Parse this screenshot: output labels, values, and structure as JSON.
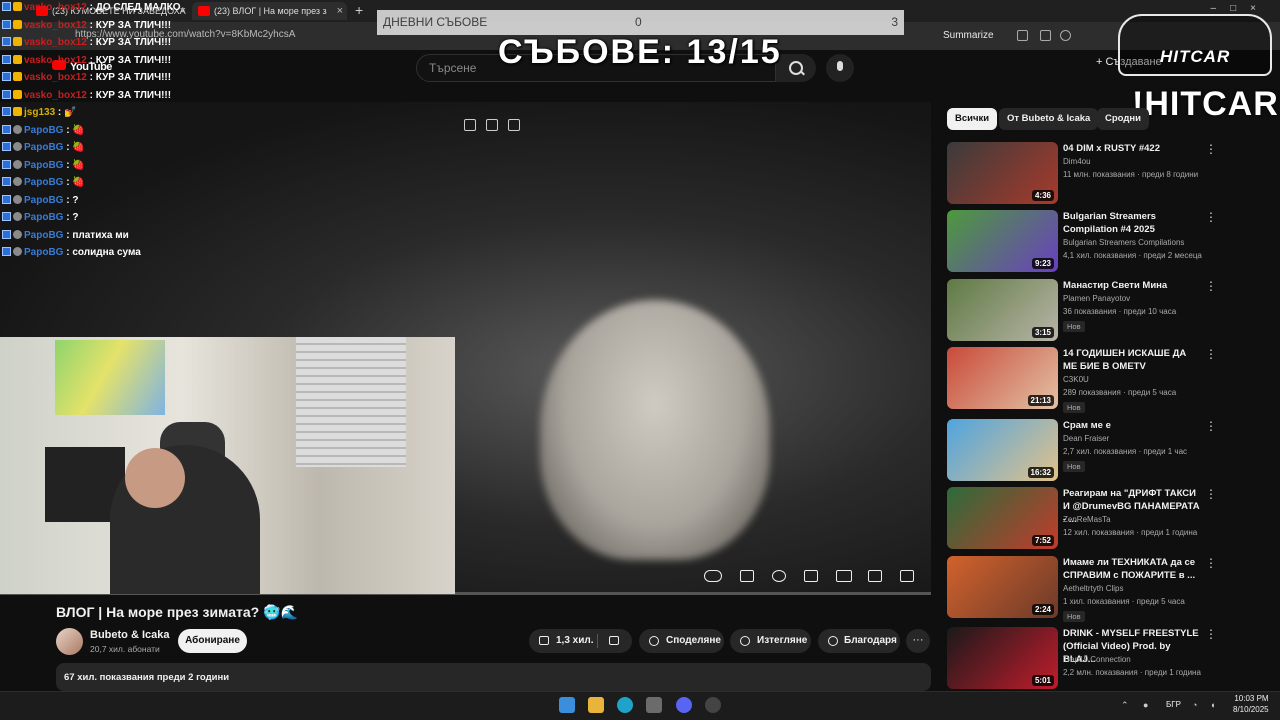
{
  "browser": {
    "tabs": [
      {
        "title": "(23) КУМОВЕТЕ НИ ЗАВЕДОХА"
      },
      {
        "title": "(23) ВЛОГ | На море през з"
      }
    ],
    "url": "https://www.youtube.com/watch?v=8KbMc2yhcsA",
    "summarize_label": "Summarize"
  },
  "youtube": {
    "logo": "YouTube",
    "search_placeholder": "Търсене",
    "create_label": "Създаване"
  },
  "overlay": {
    "counter_label": "ДНЕВНИ СЪБОВЕ",
    "counter_mid": "0",
    "counter_right": "3",
    "big_counter": "СЪБОВЕ: 13/15",
    "logo_text": "HITCAR",
    "command_text": "!HITCAR"
  },
  "chat": [
    {
      "user": "vasko_box12",
      "text": "ДО СЛЕД МАЛКО",
      "color": "#c81e1e"
    },
    {
      "user": "vasko_box12",
      "text": "КУР ЗА ТЛИЧ!!!",
      "color": "#c81e1e"
    },
    {
      "user": "vasko_box12",
      "text": "КУР ЗА ТЛИЧ!!!",
      "color": "#c81e1e"
    },
    {
      "user": "vasko_box12",
      "text": "КУР ЗА ТЛИЧ!!!",
      "color": "#c81e1e"
    },
    {
      "user": "vasko_box12",
      "text": "КУР ЗА ТЛИЧ!!!",
      "color": "#c81e1e"
    },
    {
      "user": "vasko_box12",
      "text": "КУР ЗА ТЛИЧ!!!",
      "color": "#c81e1e"
    },
    {
      "user": "jsg133",
      "text": "💅",
      "color": "#d4b000"
    },
    {
      "user": "PapoBG",
      "text": "🍓",
      "color": "#3a7bd5"
    },
    {
      "user": "PapoBG",
      "text": "🍓",
      "color": "#3a7bd5"
    },
    {
      "user": "PapoBG",
      "text": "🍓",
      "color": "#3a7bd5"
    },
    {
      "user": "PapoBG",
      "text": "🍓",
      "color": "#3a7bd5"
    },
    {
      "user": "PapoBG",
      "text": "?",
      "color": "#3a7bd5"
    },
    {
      "user": "PapoBG",
      "text": "?",
      "color": "#3a7bd5"
    },
    {
      "user": "PapoBG",
      "text": "платиха ми",
      "color": "#3a7bd5"
    },
    {
      "user": "PapoBG",
      "text": "солидна сума",
      "color": "#3a7bd5"
    }
  ],
  "video": {
    "title": "ВЛОГ | На море през зимата? 🥶🌊",
    "channel": "Bubeto & Icaka",
    "subscribers": "20,7 хил. абонати",
    "subscribe_label": "Абониране",
    "likes": "1,3 хил.",
    "share_label": "Споделяне",
    "download_label": "Изтегляне",
    "thanks_label": "Благодаря",
    "views_date": "67 хил. показвания  преди 2 години"
  },
  "sidebar": {
    "chips": [
      "Всички",
      "От Bubeto & Icaka",
      "Сродни"
    ],
    "recommendations": [
      {
        "title": "04 DIM x RUSTY #422",
        "channel": "Dim4ou",
        "meta": "11 млн. показвания · преди 8 години",
        "duration": "4:36",
        "badge": ""
      },
      {
        "title": "Bulgarian Streamers Compilation #4 2025",
        "channel": "Bulgarian Streamers Compilations",
        "meta": "4,1 хил. показвания · преди 2 месеца",
        "duration": "9:23",
        "badge": ""
      },
      {
        "title": "Манастир Свети Мина",
        "channel": "Plamen Panayotov",
        "meta": "36 показвания · преди 10 часа",
        "duration": "3:15",
        "badge": "Нов"
      },
      {
        "title": "14 ГОДИШЕН ИСКАШЕ ДА МЕ БИЕ В OMETV",
        "channel": "C3K0U",
        "meta": "289 показвания · преди 5 часа",
        "duration": "21:13",
        "badge": "Нов"
      },
      {
        "title": "Срам ме е",
        "channel": "Dean Fraiser",
        "meta": "2,7 хил. показвания · преди 1 час",
        "duration": "16:32",
        "badge": "Нов"
      },
      {
        "title": "Реагирам на \"ДРИФТ ТАКСИ И @DrumevBG ПАНАМЕРАТА - ...",
        "channel": "ZenReMasTa",
        "meta": "12 хил. показвания · преди 1 година",
        "duration": "7:52",
        "badge": ""
      },
      {
        "title": "Имаме ли ТЕХНИКАТА да се СПРАВИМ с ПОЖАРИТЕ в ...",
        "channel": "Aetheltrtyth Clips",
        "meta": "1 хил. показвания · преди 5 часа",
        "duration": "2:24",
        "badge": "Нов"
      },
      {
        "title": "DRINK - MYSELF FREESTYLE (Official Video) Prod. by BLAJ...",
        "channel": "Trap19 Connection",
        "meta": "2,2 млн. показвания · преди 1 година",
        "duration": "5:01",
        "badge": ""
      }
    ]
  },
  "taskbar": {
    "lang": "БГР",
    "time": "10:03 PM",
    "date": "8/10/2025"
  },
  "icons": {
    "search": "search-icon",
    "mic": "mic-icon",
    "like": "thumbs-up-icon",
    "dislike": "thumbs-down-icon",
    "share": "share-icon",
    "download": "download-icon",
    "thanks": "thanks-icon"
  }
}
